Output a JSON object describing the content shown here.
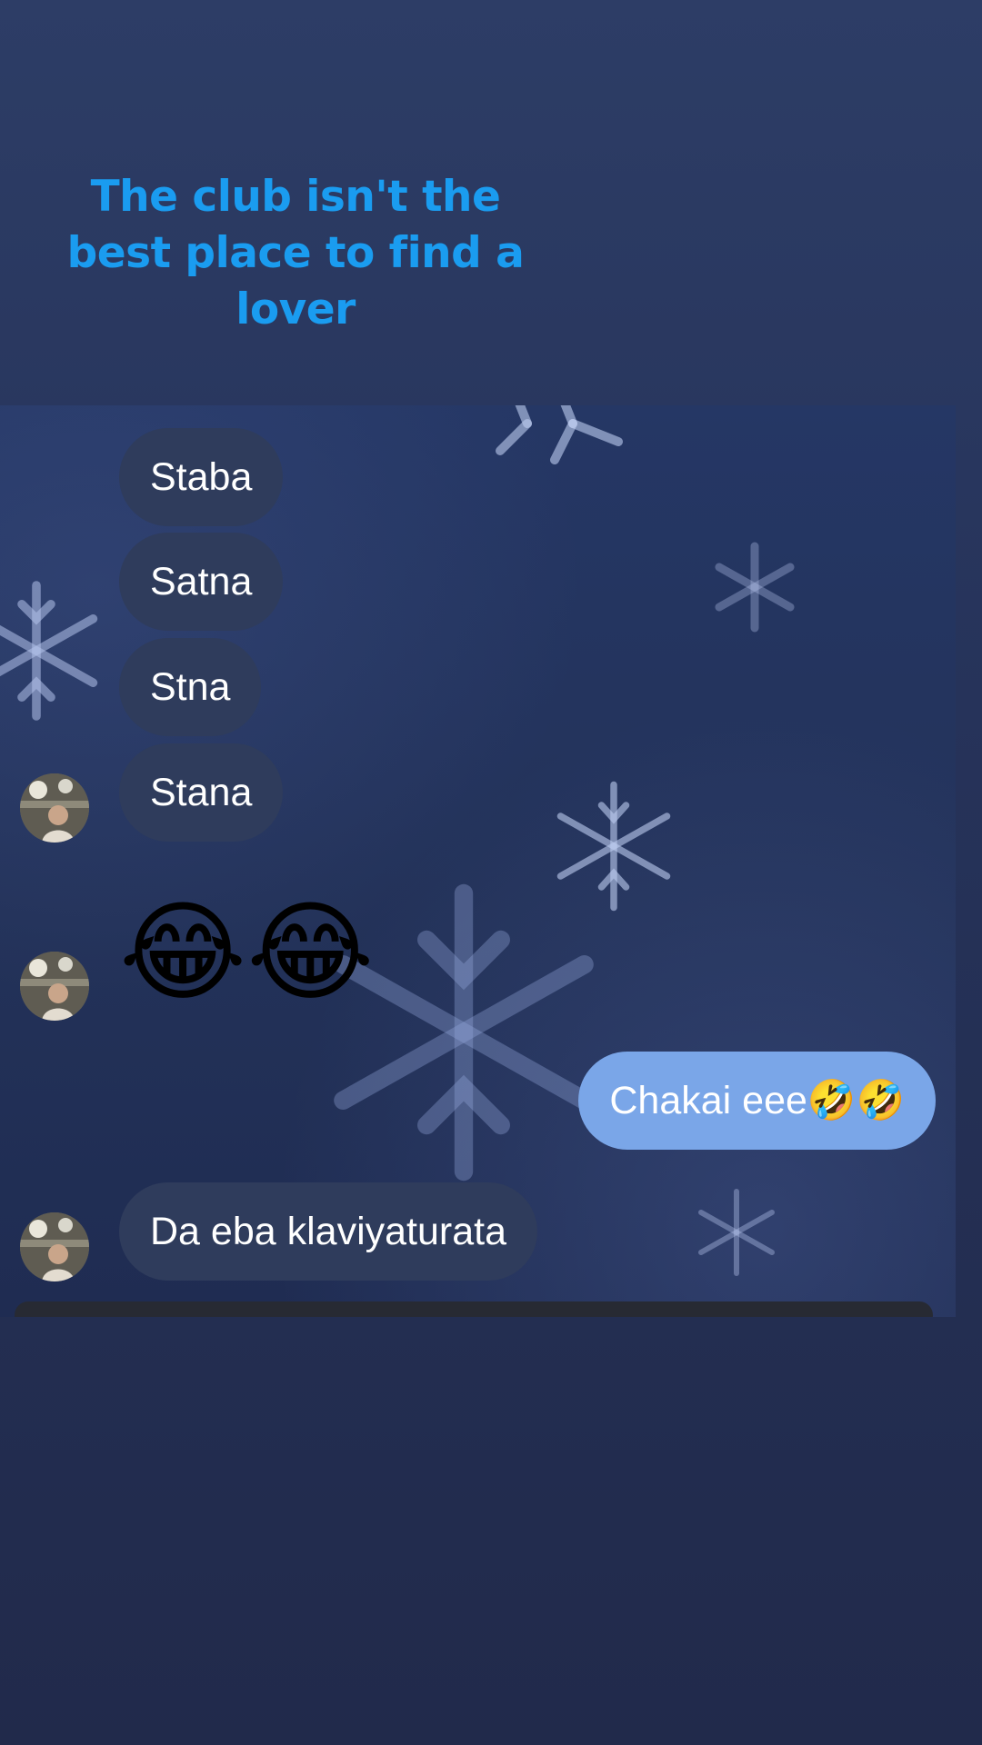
{
  "caption": {
    "text": "The club isn't the best place to find a lover",
    "color": "#1a9cf0"
  },
  "chat": {
    "messages": [
      {
        "direction": "incoming",
        "text": "Staba"
      },
      {
        "direction": "incoming",
        "text": "Satna"
      },
      {
        "direction": "incoming",
        "text": "Stna"
      },
      {
        "direction": "incoming",
        "text": "Stana"
      },
      {
        "direction": "incoming",
        "text": "😂😂"
      },
      {
        "direction": "outgoing",
        "text": "Chakai eee🤣🤣"
      },
      {
        "direction": "incoming",
        "text": "Da eba klaviyaturata"
      }
    ],
    "colors": {
      "incoming_bubble": "#2f3c5c",
      "outgoing_bubble": "#7aa6e8"
    },
    "background": "snowflake-wallpaper"
  }
}
